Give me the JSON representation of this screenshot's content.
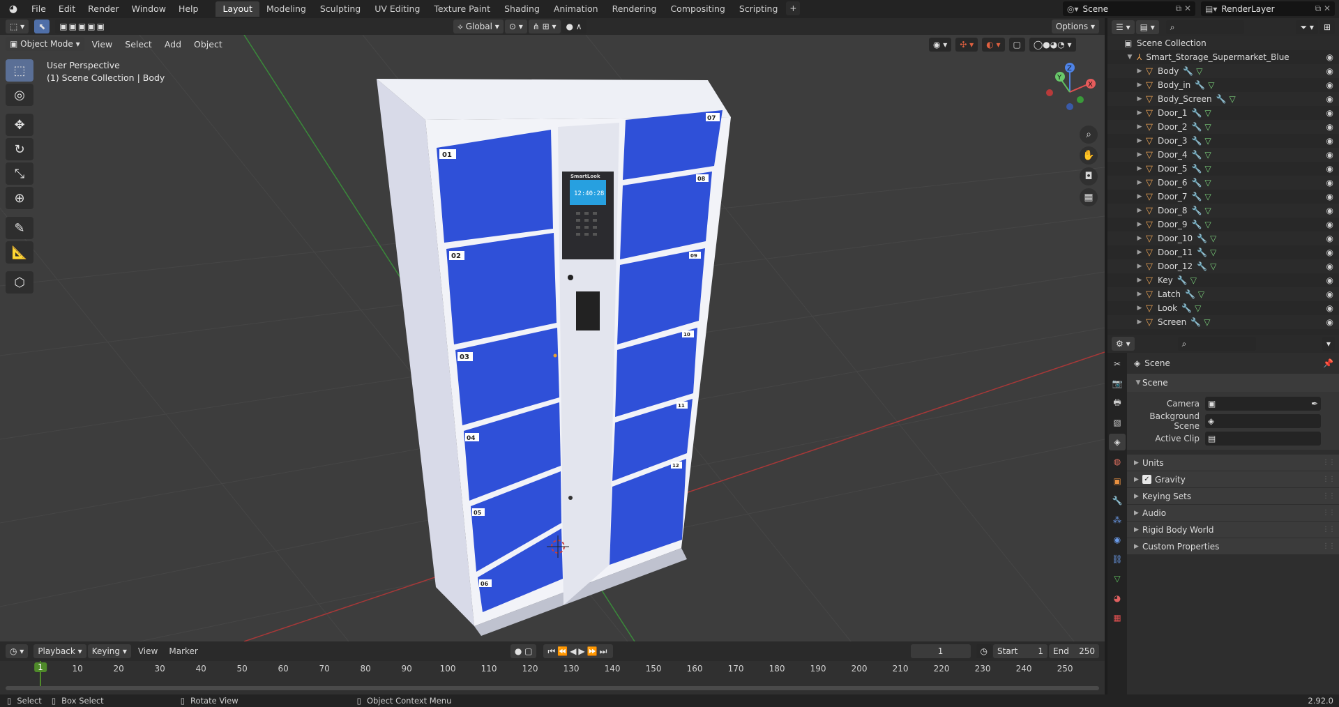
{
  "top_menu": {
    "items": [
      "File",
      "Edit",
      "Render",
      "Window",
      "Help"
    ],
    "workspaces": [
      "Layout",
      "Modeling",
      "Sculpting",
      "UV Editing",
      "Texture Paint",
      "Shading",
      "Animation",
      "Rendering",
      "Compositing",
      "Scripting"
    ],
    "active_workspace": "Layout",
    "add_workspace": "+",
    "scene_name": "Scene",
    "view_layer": "RenderLayer"
  },
  "viewport_header": {
    "mode": "Object Mode",
    "menus": [
      "View",
      "Select",
      "Add",
      "Object"
    ],
    "transform_orientation": "Global",
    "options": "Options"
  },
  "viewport": {
    "view_name": "User Perspective",
    "collection_info": "(1) Scene Collection | Body",
    "locker": {
      "brand": "SmartLook",
      "clock": "12:40:28",
      "door_labels_left": [
        "01",
        "02",
        "03",
        "04",
        "05",
        "06"
      ],
      "door_labels_right": [
        "07",
        "08",
        "09",
        "10",
        "11",
        "12"
      ]
    },
    "gizmo_axes": [
      "Z",
      "Y",
      "X"
    ],
    "colors": {
      "background": "#3d3d3d",
      "door_blue": "#2f50d8",
      "x_axis": "#b83a3a",
      "y_axis": "#3a9a3a"
    }
  },
  "toolbar": {
    "tools": [
      "select-box",
      "cursor",
      "move",
      "rotate",
      "scale",
      "transform",
      "annotate",
      "measure",
      "add-cube"
    ]
  },
  "outliner": {
    "root": "Scene Collection",
    "collection": "Smart_Storage_Supermarket_Blue",
    "objects": [
      "Body",
      "Body_in",
      "Body_Screen",
      "Door_1",
      "Door_2",
      "Door_3",
      "Door_4",
      "Door_5",
      "Door_6",
      "Door_7",
      "Door_8",
      "Door_9",
      "Door_10",
      "Door_11",
      "Door_12",
      "Key",
      "Latch",
      "Look",
      "Screen"
    ]
  },
  "properties": {
    "context": "Scene",
    "panel": "Scene",
    "fields": [
      {
        "label": "Camera",
        "value": ""
      },
      {
        "label": "Background Scene",
        "value": ""
      },
      {
        "label": "Active Clip",
        "value": ""
      }
    ],
    "sub_panels": [
      "Units",
      "Gravity",
      "Keying Sets",
      "Audio",
      "Rigid Body World",
      "Custom Properties"
    ],
    "gravity_checked": true
  },
  "timeline": {
    "menus": [
      "Playback",
      "Keying",
      "View",
      "Marker"
    ],
    "current_frame": "1",
    "start_label": "Start",
    "start": "1",
    "end_label": "End",
    "end": "250",
    "ruler": [
      "10",
      "20",
      "30",
      "40",
      "50",
      "60",
      "70",
      "80",
      "90",
      "100",
      "110",
      "120",
      "130",
      "140",
      "150",
      "160",
      "170",
      "180",
      "190",
      "200",
      "210",
      "220",
      "230",
      "240",
      "250"
    ],
    "ruler_current": "1"
  },
  "statusbar": {
    "select": "Select",
    "box_select": "Box Select",
    "rotate_view": "Rotate View",
    "context_menu": "Object Context Menu",
    "version": "2.92.0"
  }
}
